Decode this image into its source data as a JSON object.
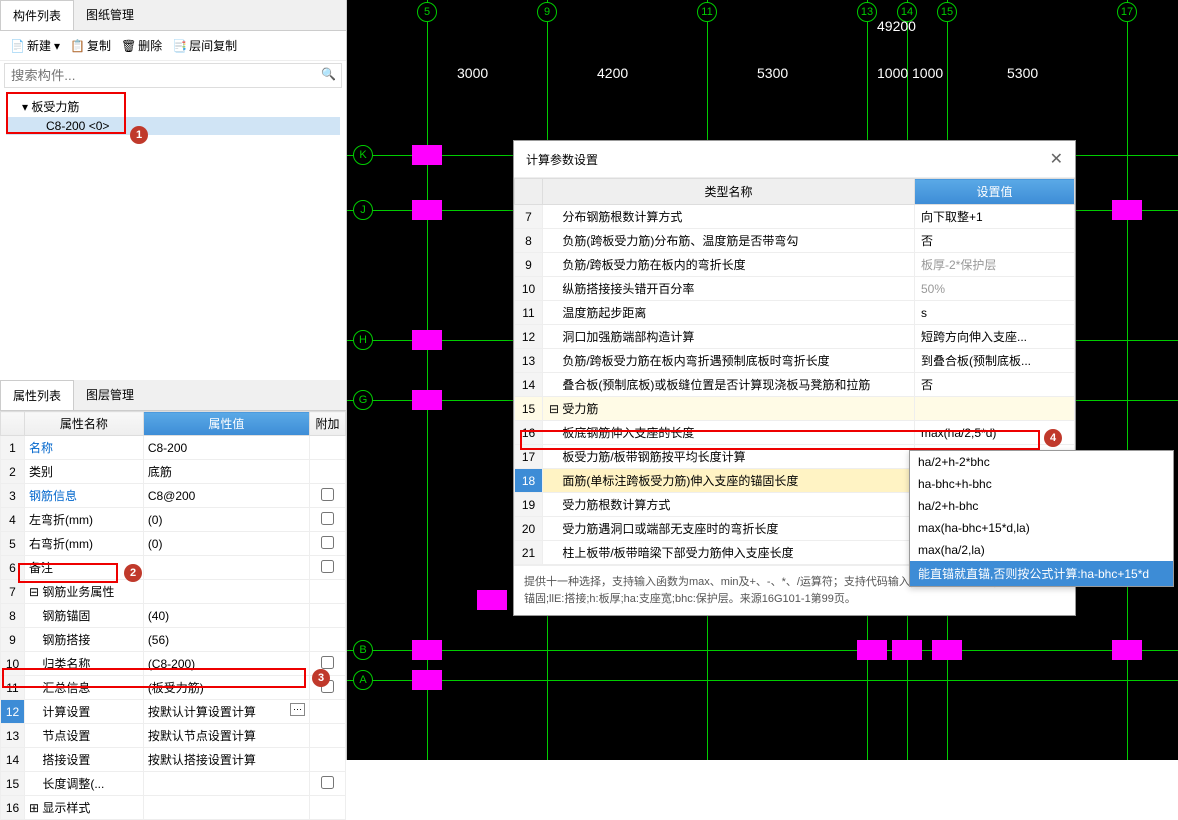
{
  "componentPanel": {
    "tabs": [
      "构件列表",
      "图纸管理"
    ],
    "toolbar": {
      "new": "新建",
      "copy": "复制",
      "delete": "删除",
      "layerCopy": "层间复制"
    },
    "searchPlaceholder": "搜索构件...",
    "tree": {
      "root": "板受力筋",
      "child": "C8-200 <0>"
    }
  },
  "propertyPanel": {
    "tabs": [
      "属性列表",
      "图层管理"
    ],
    "headers": {
      "name": "属性名称",
      "value": "属性值",
      "attach": "附加"
    },
    "rows": [
      {
        "n": "1",
        "name": "名称",
        "value": "C8-200",
        "link": true
      },
      {
        "n": "2",
        "name": "类别",
        "value": "底筋"
      },
      {
        "n": "3",
        "name": "钢筋信息",
        "value": "C8@200",
        "link": true,
        "chk": true
      },
      {
        "n": "4",
        "name": "左弯折(mm)",
        "value": "(0)",
        "chk": true
      },
      {
        "n": "5",
        "name": "右弯折(mm)",
        "value": "(0)",
        "chk": true
      },
      {
        "n": "6",
        "name": "备注",
        "value": "",
        "chk": true
      },
      {
        "n": "7",
        "name": "钢筋业务属性",
        "value": "",
        "group": true
      },
      {
        "n": "8",
        "name": "钢筋锚固",
        "value": "(40)",
        "indent": true
      },
      {
        "n": "9",
        "name": "钢筋搭接",
        "value": "(56)",
        "indent": true
      },
      {
        "n": "10",
        "name": "归类名称",
        "value": "(C8-200)",
        "indent": true,
        "chk": true
      },
      {
        "n": "11",
        "name": "汇总信息",
        "value": "(板受力筋)",
        "indent": true,
        "chk": true
      },
      {
        "n": "12",
        "name": "计算设置",
        "value": "按默认计算设置计算",
        "indent": true,
        "sel": true,
        "ellipsis": true
      },
      {
        "n": "13",
        "name": "节点设置",
        "value": "按默认节点设置计算",
        "indent": true
      },
      {
        "n": "14",
        "name": "搭接设置",
        "value": "按默认搭接设置计算",
        "indent": true
      },
      {
        "n": "15",
        "name": "长度调整(...",
        "value": "",
        "indent": true,
        "chk": true
      },
      {
        "n": "16",
        "name": "显示样式",
        "value": "",
        "group": true,
        "plus": true
      }
    ]
  },
  "canvas": {
    "topLabel": "49200",
    "dims": [
      "3000",
      "4200",
      "5300",
      "1000",
      "1000",
      "5300"
    ],
    "xBubbles": [
      "5",
      "9",
      "11",
      "13",
      "14",
      "15",
      "17"
    ],
    "yBubbles": [
      "K",
      "J",
      "H",
      "G",
      "B",
      "A"
    ]
  },
  "dialog": {
    "title": "计算参数设置",
    "headers": {
      "name": "类型名称",
      "value": "设置值"
    },
    "rows": [
      {
        "n": "7",
        "name": "分布钢筋根数计算方式",
        "value": "向下取整+1"
      },
      {
        "n": "8",
        "name": "负筋(跨板受力筋)分布筋、温度筋是否带弯勾",
        "value": "否"
      },
      {
        "n": "9",
        "name": "负筋/跨板受力筋在板内的弯折长度",
        "value": "板厚-2*保护层",
        "gray": true
      },
      {
        "n": "10",
        "name": "纵筋搭接接头错开百分率",
        "value": "50%",
        "gray": true
      },
      {
        "n": "11",
        "name": "温度筋起步距离",
        "value": "s"
      },
      {
        "n": "12",
        "name": "洞口加强筋端部构造计算",
        "value": "短跨方向伸入支座..."
      },
      {
        "n": "13",
        "name": "负筋/跨板受力筋在板内弯折遇预制底板时弯折长度",
        "value": "到叠合板(预制底板..."
      },
      {
        "n": "14",
        "name": "叠合板(预制底板)或板缝位置是否计算现浇板马凳筋和拉筋",
        "value": "否"
      },
      {
        "n": "15",
        "name": "受力筋",
        "value": "",
        "group": true
      },
      {
        "n": "16",
        "name": "板底钢筋伸入支座的长度",
        "value": "max(ha/2,5*d)"
      },
      {
        "n": "17",
        "name": "板受力筋/板带钢筋按平均长度计算",
        "value": "否"
      },
      {
        "n": "18",
        "name": "面筋(单标注跨板受力筋)伸入支座的锚固长度",
        "value": "算:ha-bhc+15*d",
        "sel": true,
        "dd": true
      },
      {
        "n": "19",
        "name": "受力筋根数计算方式",
        "value": ""
      },
      {
        "n": "20",
        "name": "受力筋遇洞口或端部无支座时的弯折长度",
        "value": ""
      },
      {
        "n": "21",
        "name": "柱上板带/板带暗梁下部受力筋伸入支座长度",
        "value": ""
      }
    ],
    "help": "提供十一种选择，支持输入函数为max、min及+、-、*、/运算符；支持代码输入；d代表钢筋直径；la:锚固;lae:锚固;llE:搭接;h:板厚;ha:支座宽;bhc:保护层。来源16G101-1第99页。",
    "dropdown": [
      "ha/2+h-2*bhc",
      "ha-bhc+h-bhc",
      "ha/2+h-bhc",
      "max(ha-bhc+15*d,la)",
      "max(ha/2,la)",
      "能直锚就直锚,否则按公式计算:ha-bhc+15*d"
    ]
  },
  "badges": {
    "b1": "1",
    "b2": "2",
    "b3": "3",
    "b4": "4"
  }
}
